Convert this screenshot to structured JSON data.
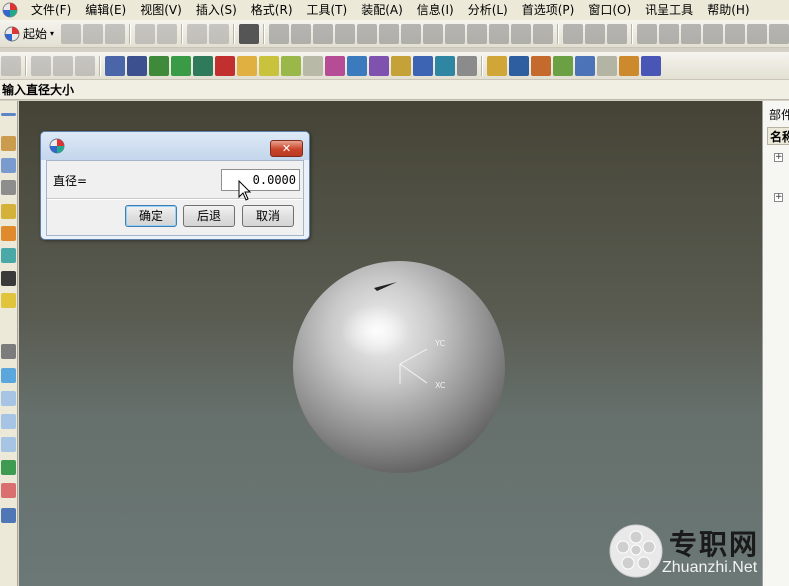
{
  "menu": [
    "文件(F)",
    "编辑(E)",
    "视图(V)",
    "插入(S)",
    "格式(R)",
    "工具(T)",
    "装配(A)",
    "信息(I)",
    "分析(L)",
    "首选项(P)",
    "窗口(O)",
    "讯呈工具",
    "帮助(H)"
  ],
  "toolbar": {
    "start_label": "起始"
  },
  "cue_line": "输入直径大小",
  "navigator": {
    "title": "部件",
    "column_header": "名称"
  },
  "dialog": {
    "field_label": "直径=",
    "field_value": "0.0000",
    "close_glyph": "✕",
    "ok_label": "确定",
    "back_label": "后退",
    "cancel_label": "取消"
  },
  "viewport": {
    "axis_y_label": "YC",
    "axis_x_label": "XC"
  },
  "watermark": {
    "text": "专职网",
    "url": "Zhuanzhi.Net"
  },
  "colors": {
    "accent": "#c9442a",
    "viewport_top": "#454336",
    "viewport_bottom": "#6b7876"
  }
}
